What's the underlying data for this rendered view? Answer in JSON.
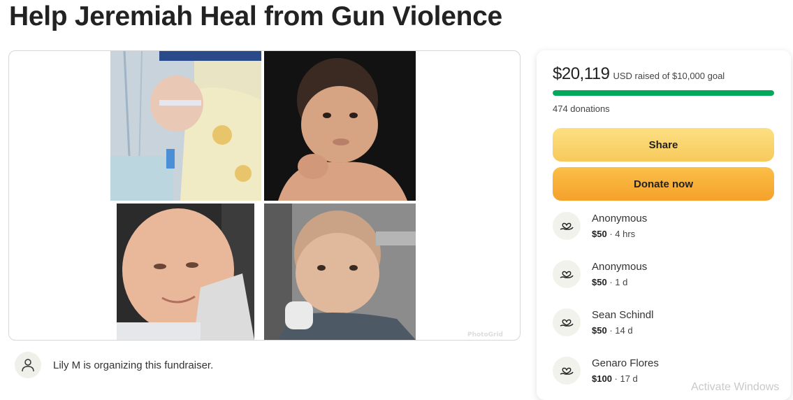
{
  "page": {
    "title": "Help Jeremiah Heal from Gun Violence"
  },
  "gallery": {
    "watermark_text": "PhotoGrid"
  },
  "organizer": {
    "text": "Lily M is organizing this fundraiser.",
    "icon": "user-icon"
  },
  "donation_panel": {
    "raised_amount": "$20,119",
    "raised_label": "USD raised of $10,000 goal",
    "progress_fraction": 1.0,
    "donation_count": "474 donations",
    "share_label": "Share",
    "donate_label": "Donate now",
    "donors": [
      {
        "name": "Anonymous",
        "amount": "$50",
        "time": " · 4 hrs"
      },
      {
        "name": "Anonymous",
        "amount": "$50",
        "time": " · 1 d"
      },
      {
        "name": "Sean Schindl",
        "amount": "$50",
        "time": " · 14 d"
      },
      {
        "name": "Genaro Flores",
        "amount": "$100",
        "time": " · 17 d"
      }
    ]
  },
  "os": {
    "watermark": "Activate Windows"
  },
  "colors": {
    "progress": "#02a95c",
    "share_button": "#f7c95b",
    "donate_button": "#f5a12b"
  }
}
